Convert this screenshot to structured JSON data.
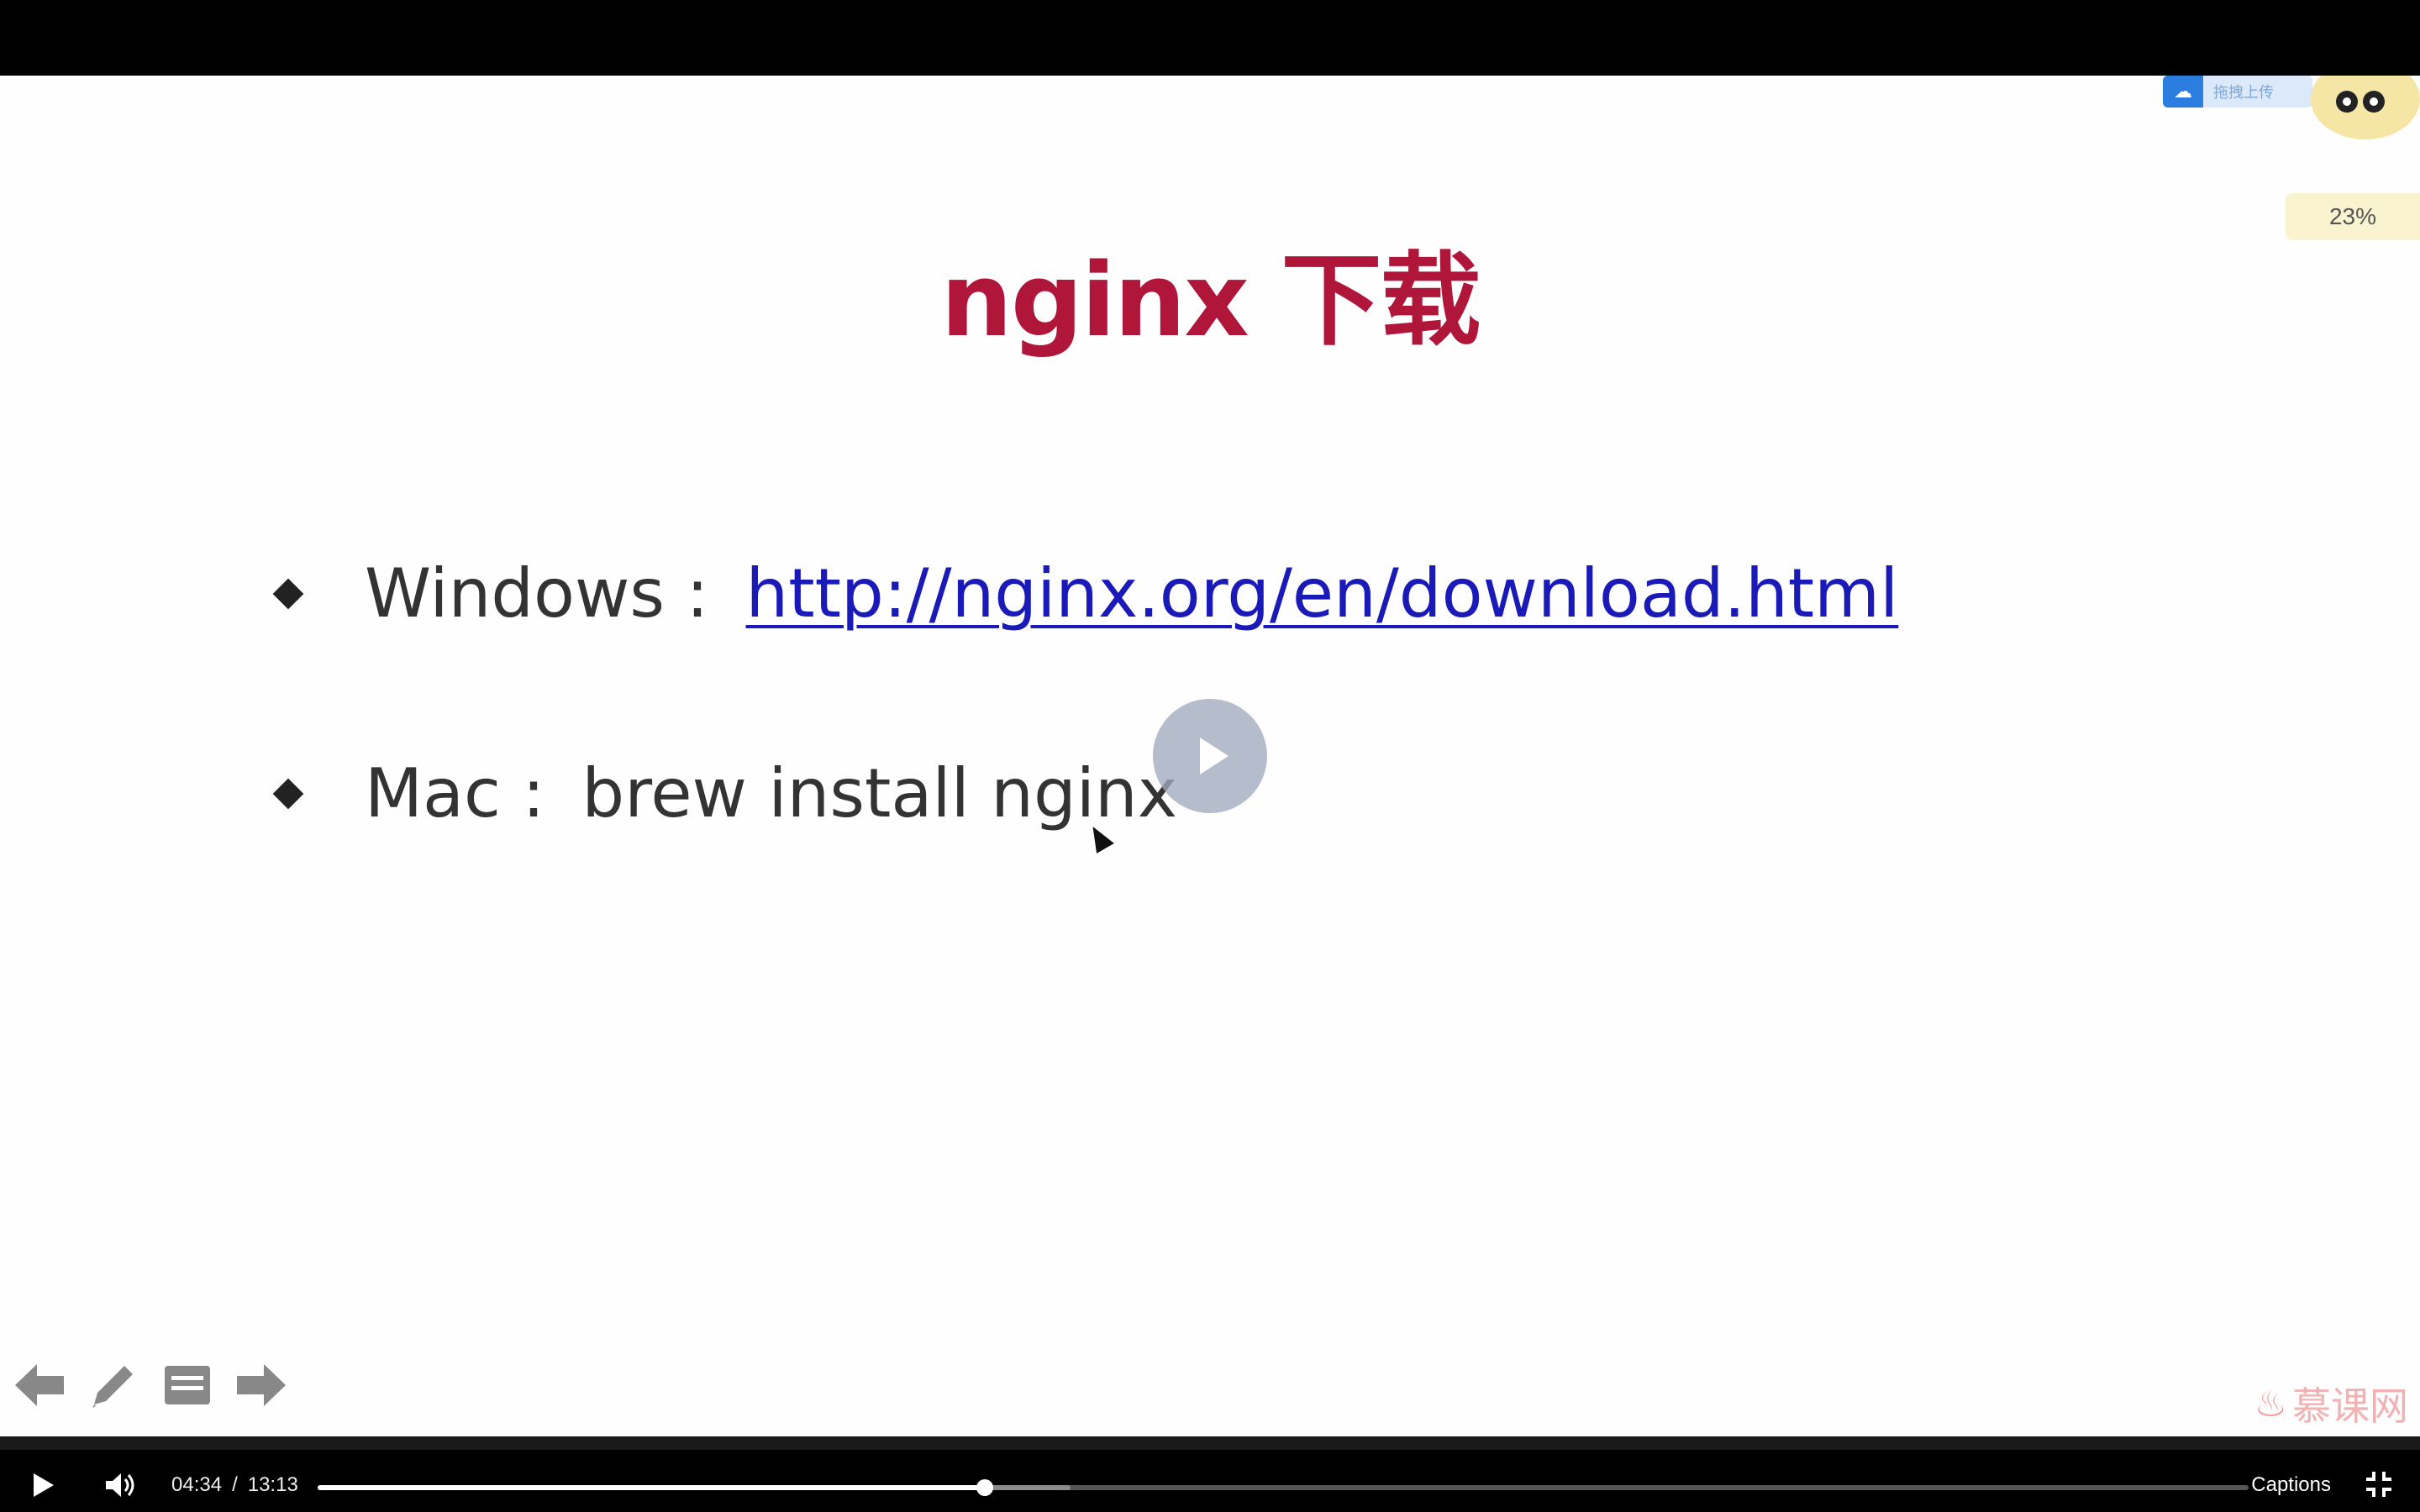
{
  "slide": {
    "title": "nginx 下载",
    "bullets": [
      {
        "label": "Windows :",
        "value": "http://nginx.org/en/download.html",
        "is_link": true
      },
      {
        "label": "Mac :",
        "value": "brew install nginx",
        "is_link": false
      }
    ]
  },
  "overlay": {
    "cloud_upload_text": "拖拽上传",
    "percent_text": "23%"
  },
  "slide_tools": {
    "prev_icon": "arrow-left-icon",
    "pen_icon": "pencil-icon",
    "notes_icon": "notes-icon",
    "next_icon": "arrow-right-icon"
  },
  "watermark": {
    "text": "慕课网"
  },
  "player": {
    "current_time": "04:34",
    "separator": "/",
    "duration": "13:13",
    "progress_fraction": 0.3455,
    "buffered_fraction": 0.39,
    "captions_label": "Captions",
    "play_icon": "play-icon",
    "volume_icon": "volume-icon",
    "fullscreen_icon": "exit-fullscreen-icon"
  },
  "colors": {
    "title": "#b0163a",
    "link": "#1a1ab8"
  }
}
